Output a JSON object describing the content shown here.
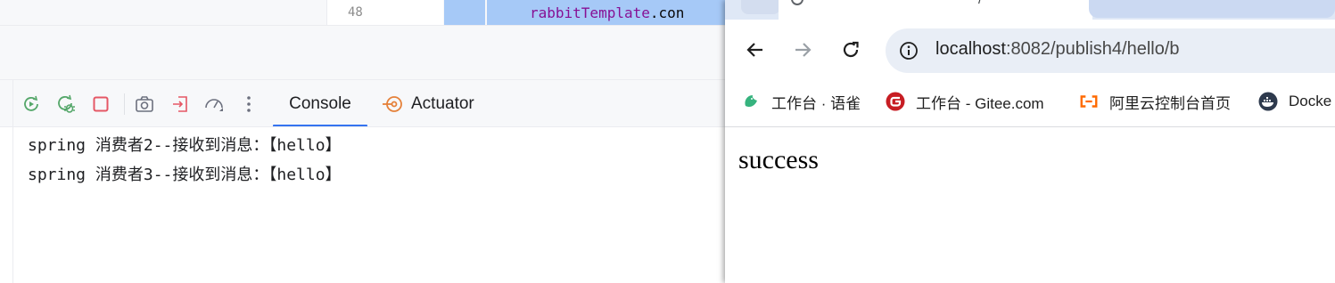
{
  "ide": {
    "editor": {
      "line_number": "48",
      "code_identifier": "rabbitTemplate",
      "code_rest": ".con"
    },
    "toolbar": {
      "icons": [
        "rerun-icon",
        "rerun-debug-icon",
        "stop-icon",
        "screenshot-icon",
        "exit-icon",
        "profiler-gauge-icon",
        "more-options-icon"
      ],
      "tabs": [
        {
          "label": "Console",
          "active": true
        },
        {
          "label": "Actuator",
          "active": false
        }
      ]
    },
    "console": {
      "lines": [
        "spring 消费者2--接收到消息：【hello】",
        "spring 消费者3--接收到消息：【hello】"
      ]
    }
  },
  "browser": {
    "url": {
      "host": "localhost",
      "path": ":8082/publish4/hello/b"
    },
    "active_tab_title_fragment": "/",
    "bookmarks": [
      {
        "label": "工作台 · 语雀",
        "icon": "yuque-icon",
        "color": "#36b37e"
      },
      {
        "label": "工作台 - Gitee.com",
        "icon": "gitee-icon",
        "color": "#c71d23"
      },
      {
        "label": "阿里云控制台首页",
        "icon": "aliyun-icon",
        "color": "#ff6a00"
      },
      {
        "label": "Docke",
        "icon": "docker-icon",
        "color": "#2e3a4d"
      }
    ],
    "page": {
      "body_text": "success"
    }
  },
  "colors": {
    "accent": "#3574f0",
    "code_identifier": "#871094",
    "editor_selection": "#a6c9f7",
    "stop_red": "#e55765",
    "actuator_orange": "#e5813a"
  }
}
